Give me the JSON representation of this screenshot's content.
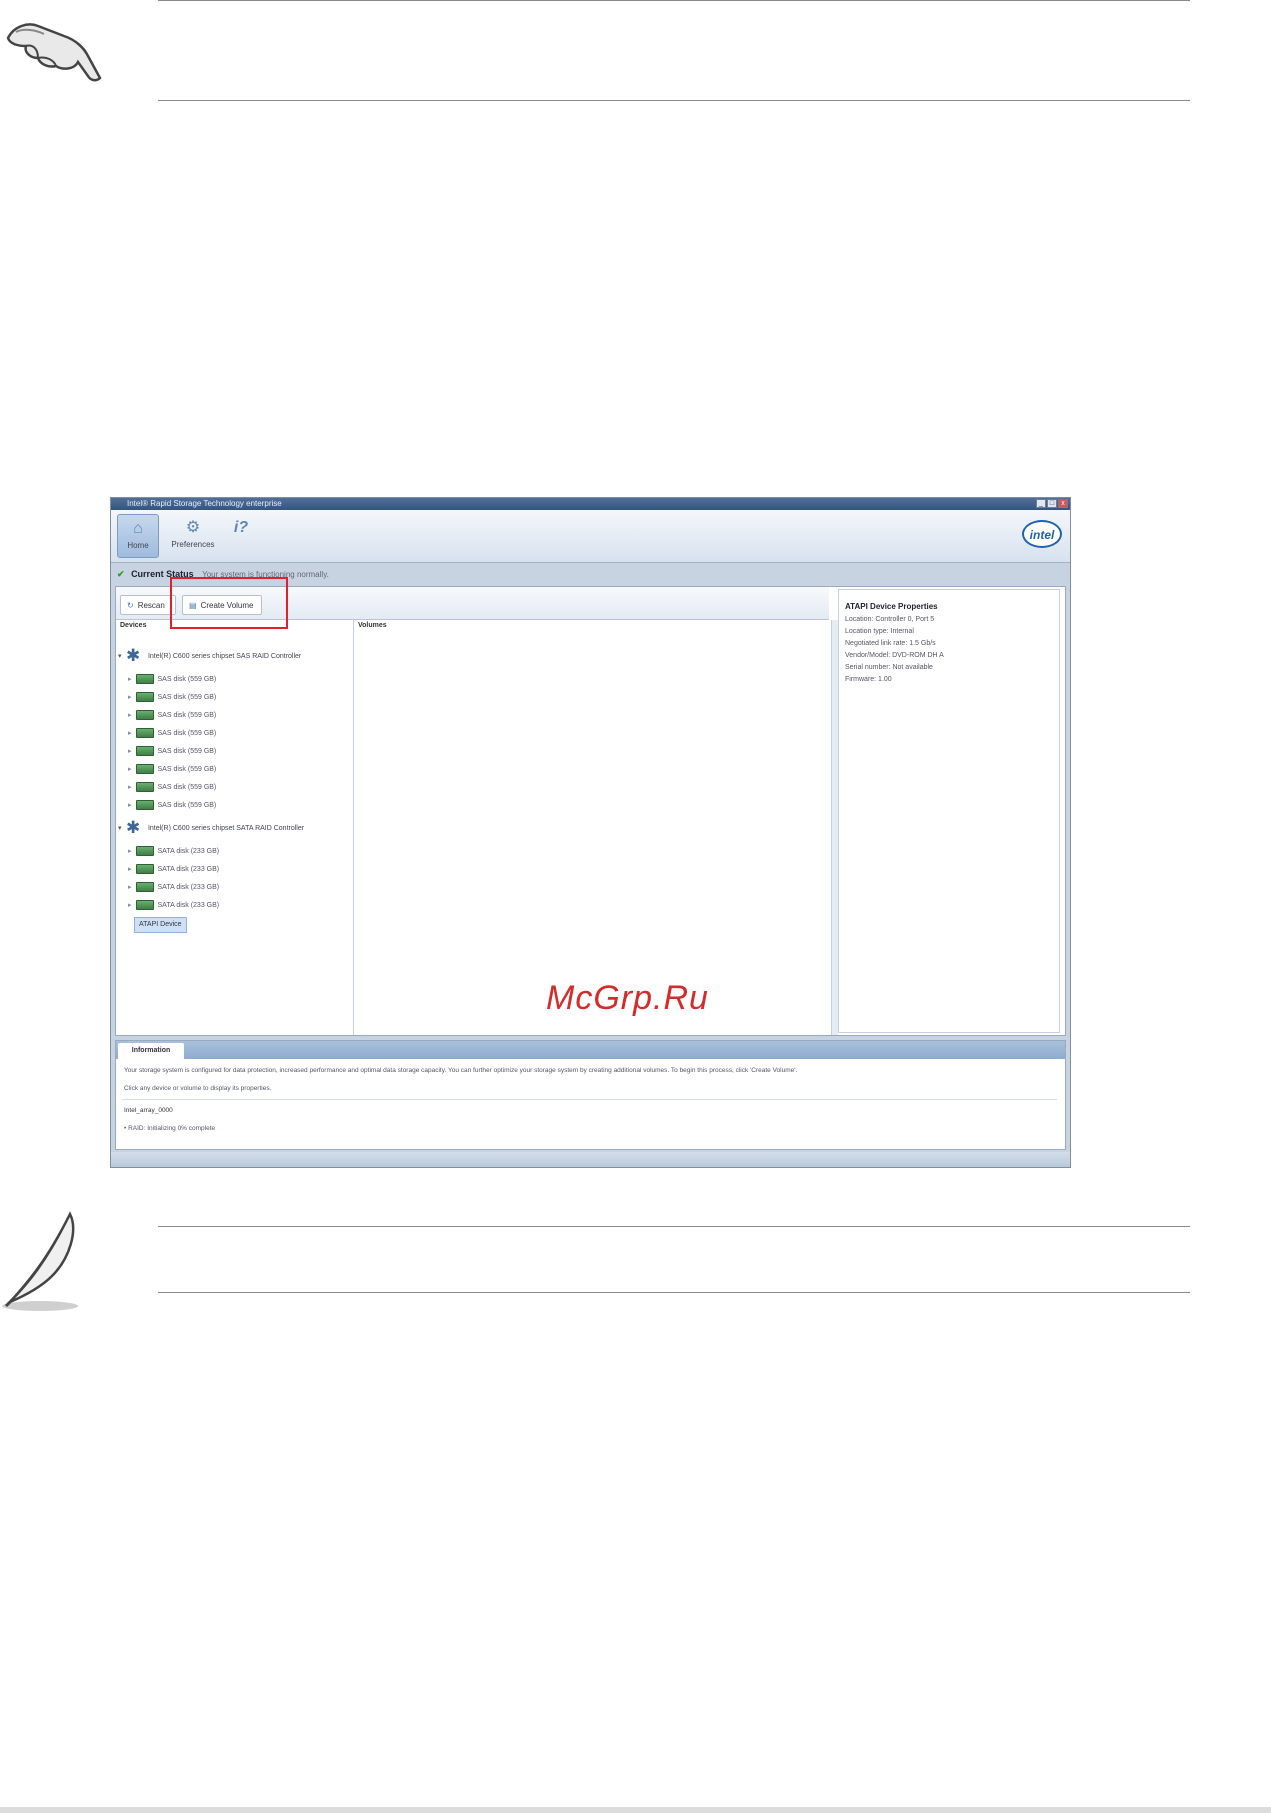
{
  "window": {
    "title": "Intel® Rapid Storage Technology enterprise",
    "window_buttons": [
      "_",
      "□",
      "x"
    ]
  },
  "toolbar": {
    "home_label": "Home",
    "preferences_label": "Preferences",
    "help_icon": "help-icon",
    "logo_text": "intel"
  },
  "status": {
    "label": "Current Status",
    "message": "Your system is functioning normally."
  },
  "actions": {
    "reset_label": "Rescan",
    "create_label": "Create Volume"
  },
  "devices": {
    "header": "Devices",
    "controllers": [
      {
        "name": "Intel(R) C600 series chipset SAS RAID Controller",
        "disks": [
          "SAS disk (559 GB)",
          "SAS disk (559 GB)",
          "SAS disk (559 GB)",
          "SAS disk (559 GB)",
          "SAS disk (559 GB)",
          "SAS disk (559 GB)",
          "SAS disk (559 GB)",
          "SAS disk (559 GB)"
        ]
      },
      {
        "name": "Intel(R) C600 series chipset SATA RAID Controller",
        "disks": [
          "SATA disk (233 GB)",
          "SATA disk (233 GB)",
          "SATA disk (233 GB)",
          "SATA disk (233 GB)"
        ]
      }
    ],
    "atapi_label": "ATAPI Device"
  },
  "volumes": {
    "header": "Volumes"
  },
  "properties": {
    "title": "ATAPI Device Properties",
    "lines": [
      "Location: Controller 0, Port 5",
      "Location type: Internal",
      "Negotiated link rate: 1.5 Gb/s",
      "Vendor/Model: DVD-ROM DH  A",
      "Serial number: Not available",
      "Firmware: 1.00"
    ]
  },
  "information": {
    "tab_label": "Information",
    "lines": [
      "Your storage system is configured for data protection, increased performance and optimal data storage capacity. You can further optimize your storage system by creating additional volumes. To begin this process, click 'Create Volume'.",
      "Click any device or volume to display its properties."
    ],
    "volume_name": "Intel_array_0000",
    "volume_status": "• RAID: Initializing 0% complete"
  },
  "watermark": "McGrp.Ru"
}
